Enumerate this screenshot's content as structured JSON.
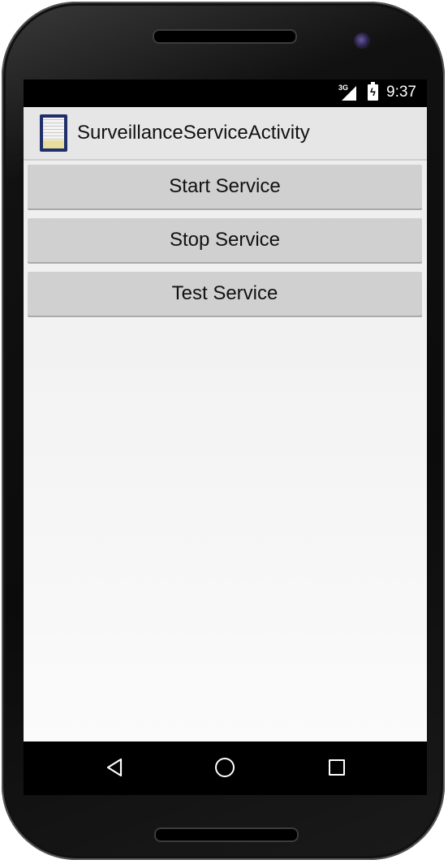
{
  "status_bar": {
    "network_label": "3G",
    "time": "9:37",
    "icons": [
      "signal-icon",
      "battery-charging-icon"
    ]
  },
  "action_bar": {
    "app_icon": "app-launcher-icon",
    "title": "SurveillanceServiceActivity"
  },
  "buttons": {
    "start_label": "Start Service",
    "stop_label": "Stop Service",
    "test_label": "Test Service"
  },
  "nav_bar": {
    "icons": [
      "back-icon",
      "home-icon",
      "recent-apps-icon"
    ]
  },
  "colors": {
    "action_bar_bg": "#e6e6e6",
    "button_bg": "#d0d0d0",
    "content_bg": "#f5f5f5",
    "status_bar_bg": "#000000"
  }
}
